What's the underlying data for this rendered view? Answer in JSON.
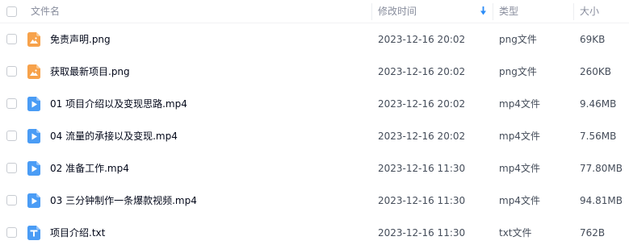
{
  "header": {
    "name_label": "文件名",
    "mtime_label": "修改时间",
    "sort_direction": "descending",
    "type_label": "类型",
    "size_label": "大小"
  },
  "files": [
    {
      "name": "免责声明.png",
      "mtime": "2023-12-16 20:02",
      "type": "png文件",
      "size": "69KB",
      "icon": "image-file-icon"
    },
    {
      "name": "获取最新项目.png",
      "mtime": "2023-12-16 20:02",
      "type": "png文件",
      "size": "260KB",
      "icon": "image-file-icon"
    },
    {
      "name": "01 项目介绍以及变现思路.mp4",
      "mtime": "2023-12-16 20:02",
      "type": "mp4文件",
      "size": "9.46MB",
      "icon": "video-file-icon"
    },
    {
      "name": "04 流量的承接以及变现.mp4",
      "mtime": "2023-12-16 20:02",
      "type": "mp4文件",
      "size": "7.56MB",
      "icon": "video-file-icon"
    },
    {
      "name": "02 准备工作.mp4",
      "mtime": "2023-12-16 11:30",
      "type": "mp4文件",
      "size": "77.80MB",
      "icon": "video-file-icon"
    },
    {
      "name": "03 三分钟制作一条爆款视频.mp4",
      "mtime": "2023-12-16 11:30",
      "type": "mp4文件",
      "size": "94.81MB",
      "icon": "video-file-icon"
    },
    {
      "name": "项目介绍.txt",
      "mtime": "2023-12-16 11:30",
      "type": "txt文件",
      "size": "762B",
      "icon": "text-file-icon"
    }
  ],
  "colors": {
    "image_icon": "#f7a24b",
    "video_icon": "#4a9cf5",
    "text_icon": "#4a9cf5",
    "sort_arrow": "#2b8cf7"
  }
}
